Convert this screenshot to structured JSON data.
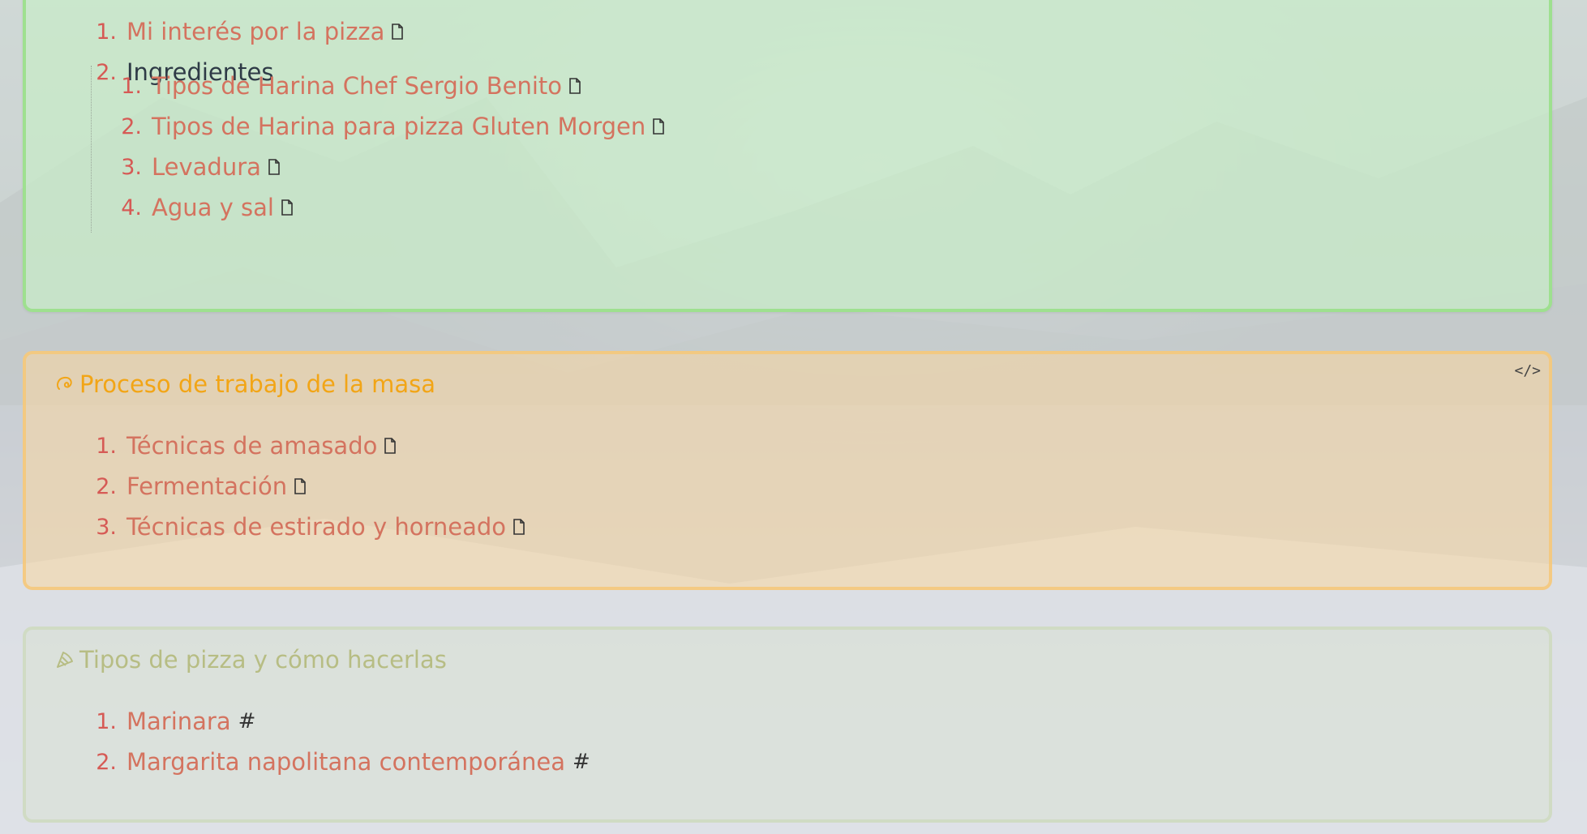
{
  "sections": {
    "intro": {
      "items": [
        {
          "num": "1.",
          "label": "Mi interés por la pizza"
        },
        {
          "num": "2.",
          "label": "Ingredientes"
        }
      ],
      "subitems": [
        {
          "num": "1.",
          "label": "Tipos de Harina Chef Sergio Benito"
        },
        {
          "num": "2.",
          "label": "Tipos de Harina para pizza Gluten Morgen"
        },
        {
          "num": "3.",
          "label": "Levadura"
        },
        {
          "num": "4.",
          "label": "Agua y sal"
        }
      ]
    },
    "proceso": {
      "title": "Proceso de trabajo de la masa",
      "embed_label": "</>",
      "items": [
        {
          "num": "1.",
          "label": "Técnicas de amasado"
        },
        {
          "num": "2.",
          "label": "Fermentación"
        },
        {
          "num": "3.",
          "label": "Técnicas de estirado y horneado"
        }
      ]
    },
    "tipos": {
      "title": "Tipos de pizza y cómo hacerlas",
      "items": [
        {
          "num": "1.",
          "label": "Marinara",
          "suffix": "#"
        },
        {
          "num": "2.",
          "label": "Margarita napolitana contemporánea",
          "suffix": "#"
        }
      ]
    }
  },
  "icons": {
    "page": "document-icon",
    "proceso_title": "dough-icon",
    "tipos_title": "pizza-slice-icon",
    "embed": "code-icon"
  },
  "colors": {
    "green_border": "#9ee08f",
    "orange_title": "#f2a516",
    "olive_title": "#b7bd84",
    "link": "#d4735f",
    "number": "#d65a55"
  }
}
